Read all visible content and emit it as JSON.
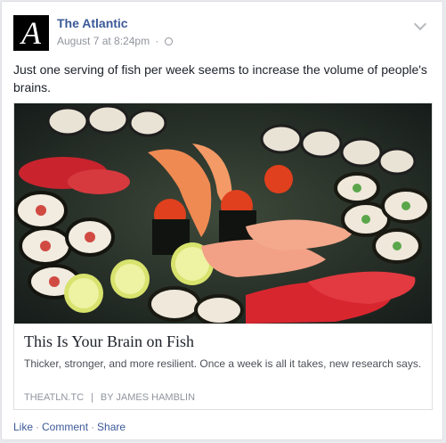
{
  "post": {
    "page_name": "The Atlantic",
    "logo_letter": "A",
    "date": "August 7 at 8:24pm",
    "separator": "·",
    "audience_icon": "globe-icon",
    "menu_icon": "chevron-down-icon",
    "text": "Just one serving of fish per week seems to increase the volume of people's brains."
  },
  "link": {
    "image_alt": "Platter of sushi rolls and nigiri",
    "title": "This Is Your Brain on Fish",
    "description": "Thicker, stronger, and more resilient. Once a week is all it takes, new research says.",
    "domain": "THEATLN.TC",
    "divider": "|",
    "byline": "BY JAMES HAMBLIN"
  },
  "actions": {
    "like": "Like",
    "comment": "Comment",
    "share": "Share",
    "dot": "·"
  },
  "colors": {
    "link_blue": "#3b5998",
    "meta_gray": "#90949c",
    "text": "#1d2129"
  }
}
